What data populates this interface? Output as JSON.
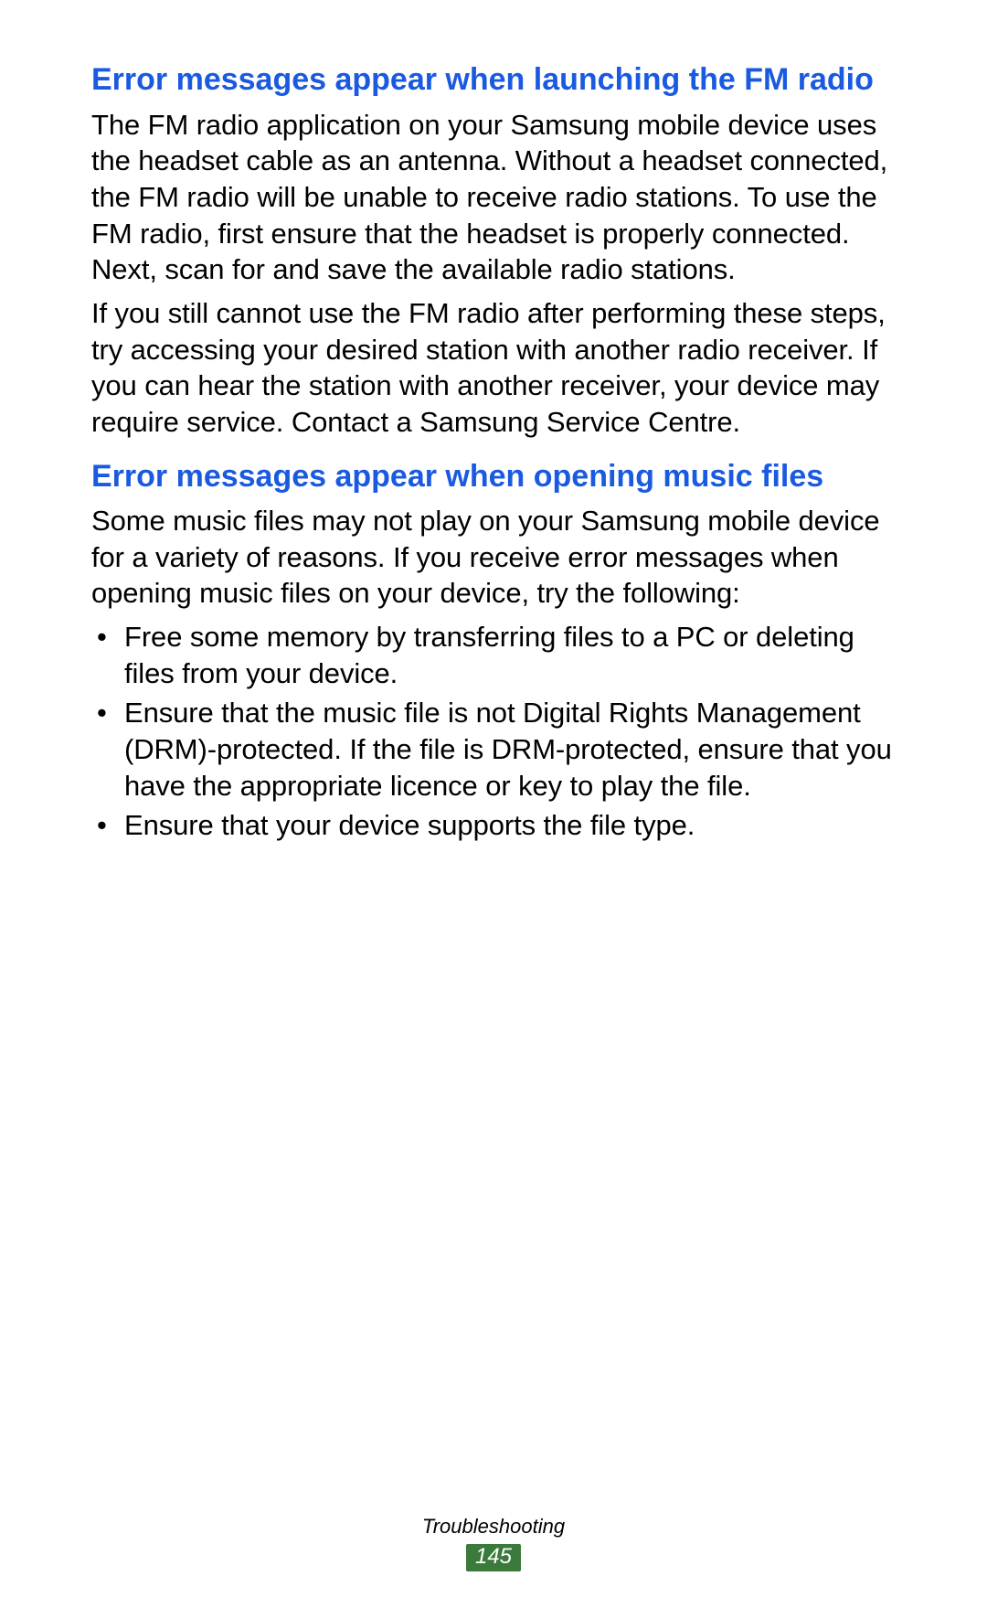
{
  "sections": [
    {
      "heading": "Error messages appear when launching the FM radio",
      "paragraphs": [
        "The FM radio application on your Samsung mobile device uses the headset cable as an antenna. Without a headset connected, the FM radio will be unable to receive radio stations. To use the FM radio, first ensure that the headset is properly connected. Next, scan for and save the available radio stations.",
        "If you still cannot use the FM radio after performing these steps, try accessing your desired station with another radio receiver. If you can hear the station with another receiver, your device may require service. Contact a Samsung Service Centre."
      ]
    },
    {
      "heading": "Error messages appear when opening music files",
      "paragraphs": [
        "Some music files may not play on your Samsung mobile device for a variety of reasons. If you receive error messages when opening music files on your device, try the following:"
      ],
      "bullets": [
        "Free some memory by transferring files to a PC or deleting files from your device.",
        "Ensure that the music file is not Digital Rights Management (DRM)-protected. If the file is DRM-protected, ensure that you have the appropriate licence or key to play the file.",
        "Ensure that your device supports the file type."
      ]
    }
  ],
  "footer": {
    "section_label": "Troubleshooting",
    "page_number": "145"
  }
}
